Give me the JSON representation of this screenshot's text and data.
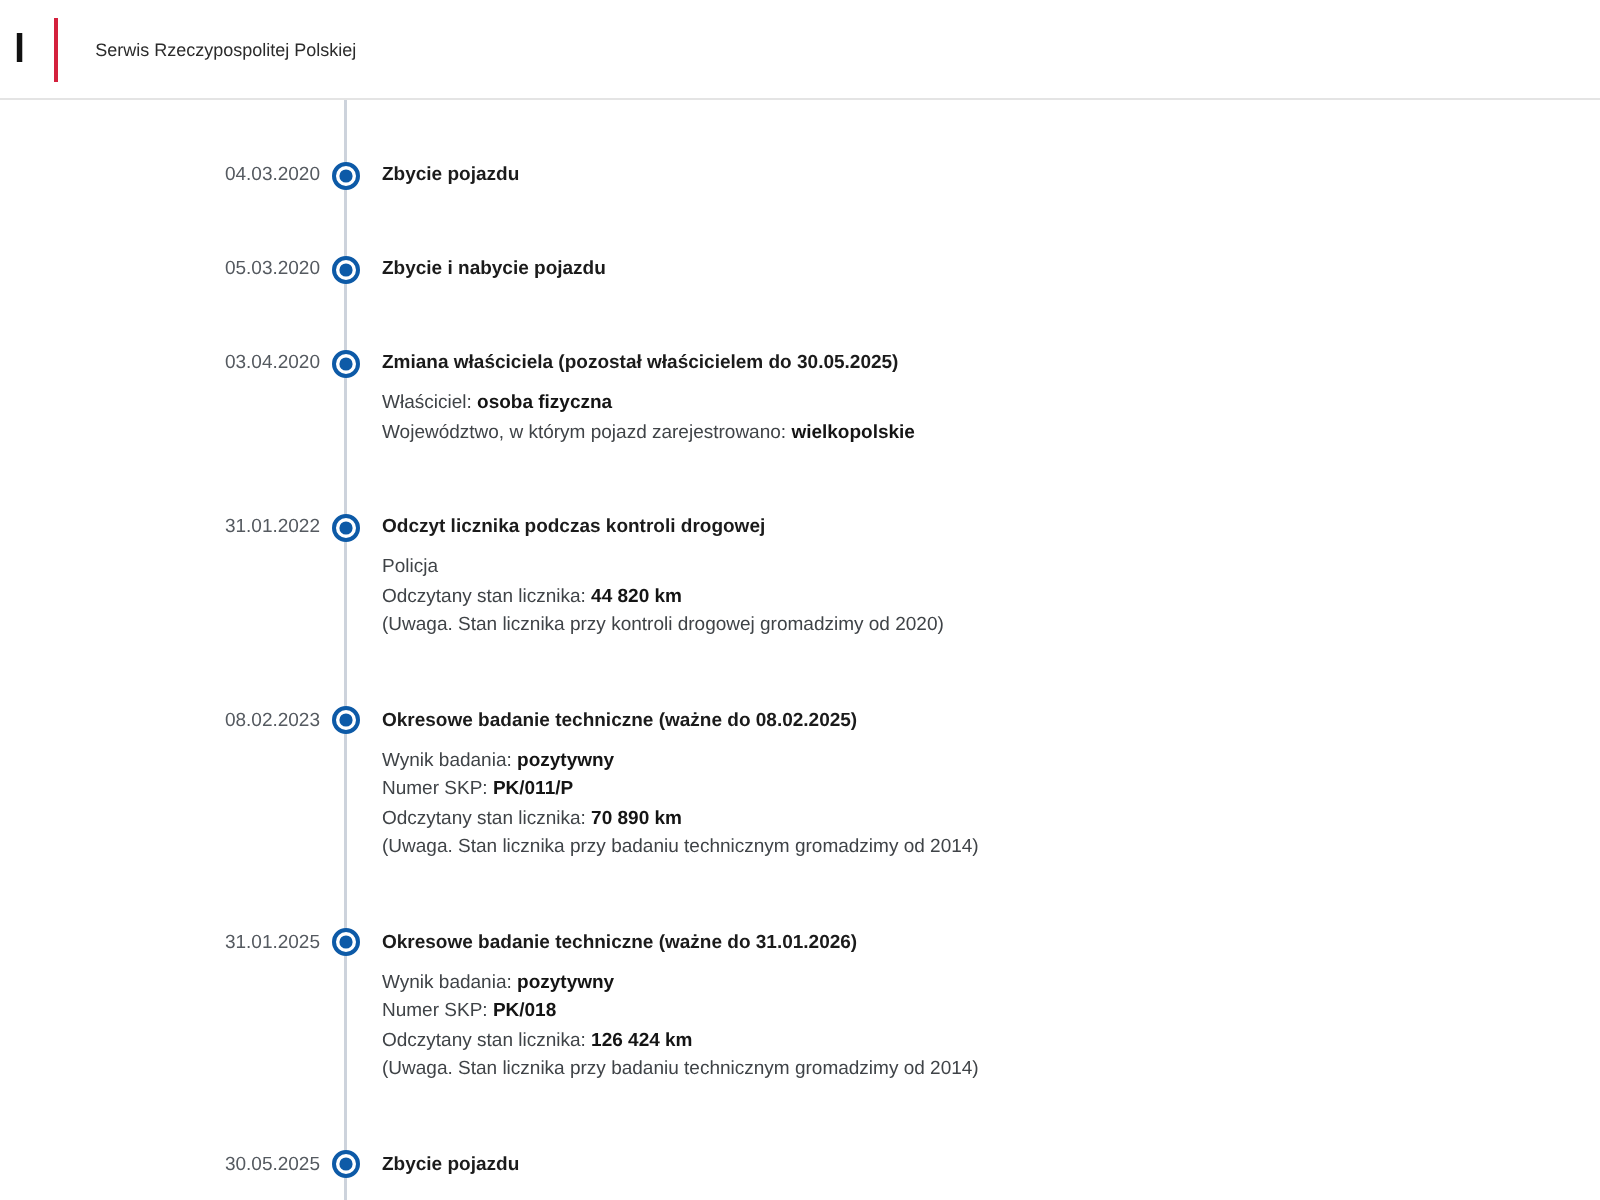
{
  "header": {
    "logo_text": "l",
    "service_name": "Serwis Rzeczypospolitej Polskiej"
  },
  "timeline": {
    "events": [
      {
        "date": "04.03.2020",
        "title": "Zbycie pojazdu"
      },
      {
        "date": "05.03.2020",
        "title": "Zbycie i nabycie pojazdu"
      },
      {
        "date": "03.04.2020",
        "title": "Zmiana właściciela (pozostał właścicielem do 30.05.2025)",
        "details": [
          "Właściciel: **osoba fizyczna**",
          "Województwo, w którym pojazd zarejestrowano: **wielkopolskie**"
        ]
      },
      {
        "date": "31.01.2022",
        "title": "Odczyt licznika podczas kontroli drogowej",
        "details": [
          "Policja",
          "Odczytany stan licznika: **44 820 km**",
          "(Uwaga. Stan licznika przy kontroli drogowej gromadzimy od 2020)"
        ]
      },
      {
        "date": "08.02.2023",
        "title": "Okresowe badanie techniczne (ważne do 08.02.2025)",
        "details": [
          "Wynik badania: **pozytywny**",
          "Numer SKP: **PK/011/P**",
          "Odczytany stan licznika: **70 890 km**",
          "(Uwaga. Stan licznika przy badaniu technicznym gromadzimy od 2014)"
        ]
      },
      {
        "date": "31.01.2025",
        "title": "Okresowe badanie techniczne (ważne do 31.01.2026)",
        "details": [
          "Wynik badania: **pozytywny**",
          "Numer SKP: **PK/018**",
          "Odczytany stan licznika: **126 424 km**",
          "(Uwaga. Stan licznika przy badaniu technicznym gromadzimy od 2014)"
        ]
      },
      {
        "date": "30.05.2025",
        "title": "Zbycie pojazdu"
      }
    ]
  }
}
